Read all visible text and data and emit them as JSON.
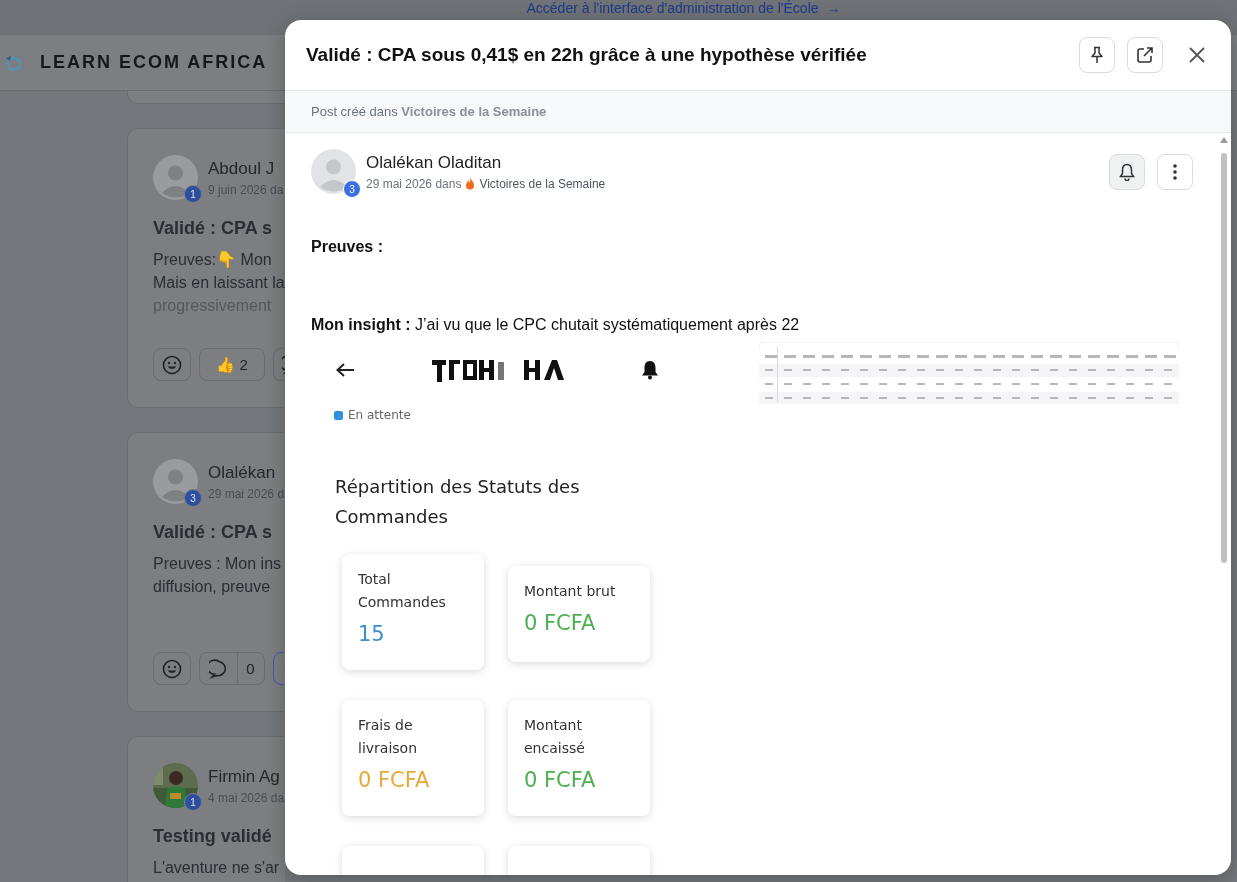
{
  "banner": {
    "link": "Accéder à l'interface d'administration de l'École",
    "arrow": "→"
  },
  "header": {
    "brand": "LEARN ECOM AFRICA"
  },
  "feed": [
    {
      "author": "Abdoul J",
      "badge": "1",
      "kind": "silhouette",
      "meta": "9 juin 2026 da",
      "title": "Validé : CPA s",
      "lines": [
        "Preuves:👇  Mon",
        "Mais en laissant la",
        "progressivement"
      ],
      "reactions": [
        {
          "kind": "emoji"
        },
        {
          "kind": "count",
          "emoji": "👍",
          "count": "2"
        },
        {
          "kind": "comment"
        }
      ]
    },
    {
      "author": "Olalékan",
      "badge": "3",
      "kind": "silhouette",
      "meta": "29 mai 2026 d",
      "title": "Validé : CPA s",
      "lines": [
        "Preuves : Mon ins",
        "diffusion, preuve"
      ],
      "reactions": [
        {
          "kind": "emoji"
        },
        {
          "kind": "comment",
          "count": "0"
        },
        {
          "kind": "outline"
        }
      ]
    },
    {
      "author": "Firmin Ag",
      "badge": "1",
      "meta": "4 mai 2026 da",
      "title": "Testing validé",
      "lines": [
        "L'aventure ne s'ar"
      ]
    }
  ],
  "modal": {
    "title": "Validé : CPA sous 0,41$ en 22h grâce à une hypothèse vérifiée",
    "posted_in": "Post créé dans **Victoires de la Semaine**",
    "author": {
      "name": "Olalékan Oladitan",
      "badge": "3",
      "date": "29 mai 2026 dans",
      "space": "Victoires de la Semaine"
    },
    "paragraphs": [
      {
        "text": "Preuves :",
        "bold": true
      },
      {
        "text": "**Mon insight :** J’ai vu que le CPC chutait systématiquement après 22",
        "bold": false
      }
    ],
    "screenshot": {
      "legend": {
        "label": "En attente",
        "color": "#2f8fe0"
      },
      "heading": "Répartition des Statuts des Commandes",
      "stats": [
        {
          "label": "Total Commandes",
          "value": "15",
          "color": "#3a8fd0"
        },
        {
          "label": "Montant brut",
          "value": "0 FCFA",
          "color": "#4caf50"
        },
        {
          "label": "Frais de livraison",
          "value": "0 FCFA",
          "color": "#e8a838"
        },
        {
          "label": "Montant encaissé",
          "value": "0 FCFA",
          "color": "#4caf50"
        }
      ]
    }
  }
}
